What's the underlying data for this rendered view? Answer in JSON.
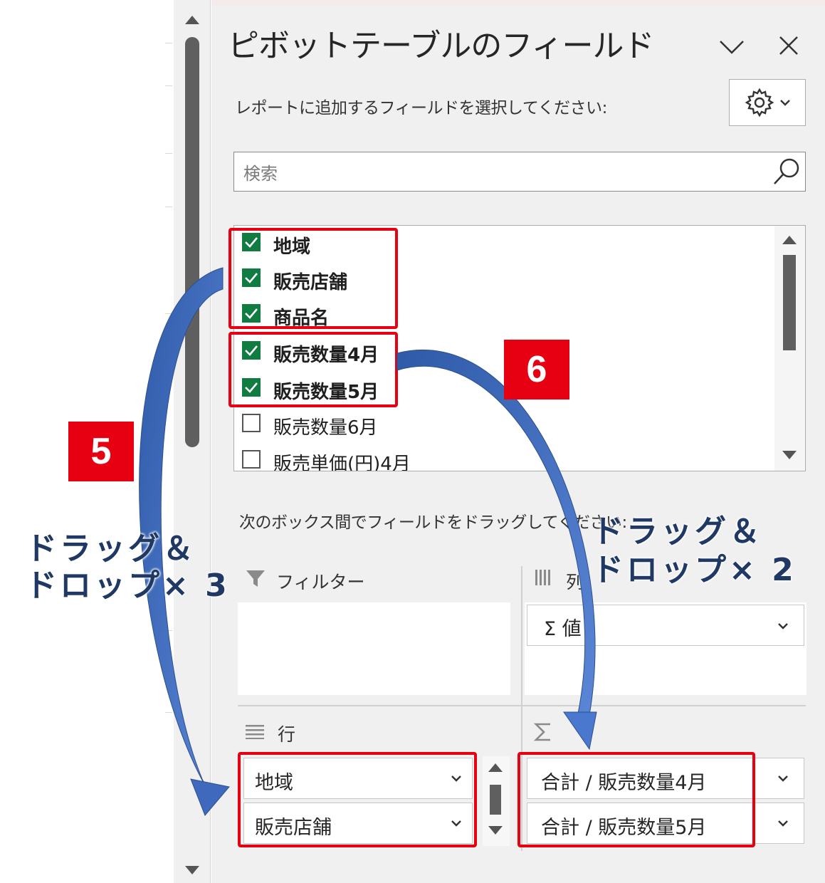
{
  "panel": {
    "title": "ピボットテーブルのフィールド",
    "subtitle": "レポートに追加するフィールドを選択してください:",
    "search_placeholder": "検索",
    "instruction": "次のボックス間でフィールドをドラッグしてください:"
  },
  "fields": [
    {
      "label": "地域",
      "checked": true
    },
    {
      "label": "販売店舗",
      "checked": true
    },
    {
      "label": "商品名",
      "checked": true
    },
    {
      "label": "販売数量4月",
      "checked": true
    },
    {
      "label": "販売数量5月",
      "checked": true
    },
    {
      "label": "販売数量6月",
      "checked": false
    },
    {
      "label": "販売単価(円)4月",
      "checked": false
    }
  ],
  "areas": {
    "filter": {
      "title": "フィルター"
    },
    "columns": {
      "title": "列",
      "items": [
        "Σ 値"
      ]
    },
    "rows": {
      "title": "行",
      "items": [
        "地域",
        "販売店舗"
      ]
    },
    "values": {
      "title": "Σ",
      "items": [
        "合計 / 販売数量4月",
        "合計 / 販売数量5月"
      ]
    }
  },
  "annotations": {
    "badge5": "5",
    "badge6": "6",
    "callout_left_line1": "ドラッグ＆",
    "callout_left_line2": "ドロップ× 3",
    "callout_right_line1": "ドラッグ＆",
    "callout_right_line2": "ドロップ× 2",
    "highlight_color": "#e60012",
    "arrow_color": "#4472c4"
  },
  "icons": [
    "chevron-down-icon",
    "close-icon",
    "gear-icon",
    "search-icon",
    "filter-icon",
    "columns-icon",
    "rows-icon",
    "sigma-icon",
    "checkmark-icon"
  ]
}
